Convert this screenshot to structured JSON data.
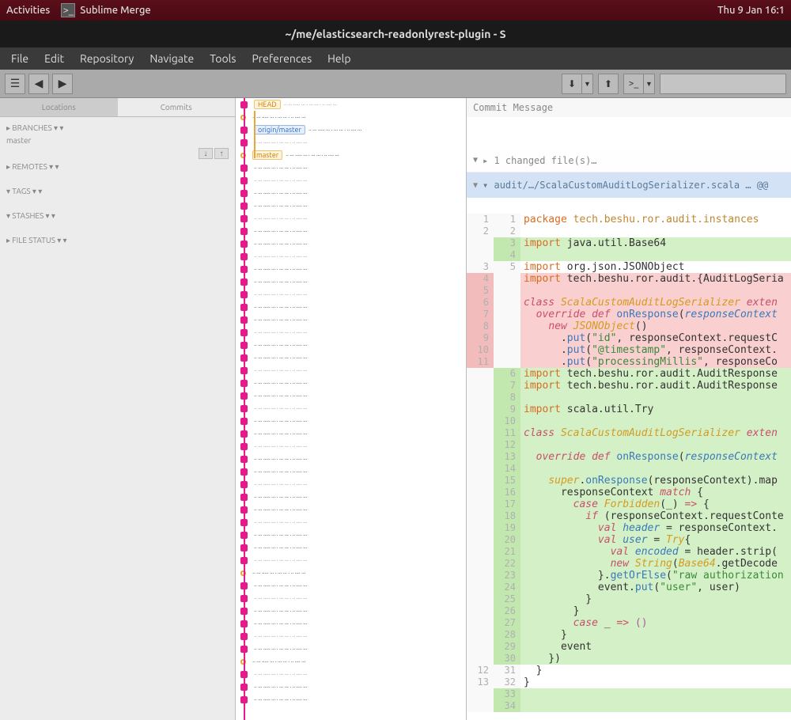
{
  "ubuntu": {
    "activities": "Activities",
    "app_icon_glyph": ">_",
    "app_name": "Sublime Merge",
    "clock": "Thu 9 Jan  16:1"
  },
  "window": {
    "title": "~/me/elasticsearch-readonlyrest-plugin - S"
  },
  "menu": [
    "File",
    "Edit",
    "Repository",
    "Navigate",
    "Tools",
    "Preferences",
    "Help"
  ],
  "toolbar": {
    "hamburger": "☰",
    "back": "◀",
    "forward": "▶",
    "pull_icon": "⬇",
    "push_icon": "⬆",
    "stash_icon": ">_",
    "drop_glyph": "▼",
    "search_placeholder": ""
  },
  "sidebar": {
    "tab1": "Locations",
    "tab2": "Commits",
    "branch1": "▸ BRANCHES ▾ ▾",
    "branch1b": "   master",
    "remotes": "▸ REMOTES ▾ ▾",
    "tags": "▾ TAGS ▾ ▾",
    "stashes": "▾ STASHES ▾ ▾",
    "submodules": "",
    "more": "▸ FILE STATUS ▾ ▾"
  },
  "graph_tags": {
    "head": "HEAD",
    "origin_master": "origin/master",
    "master": "master"
  },
  "diff": {
    "commit_msg_label": "Commit Message",
    "files_label": "▸ 1 changed file(s)…",
    "hunk_label": "▾ audit/…/ScalaCustomAuditLogSerializer.scala … @@"
  },
  "code_lines": [
    {
      "lo": "1",
      "ln": "1",
      "t": "context",
      "html": "<span class='kw2'>package</span> <span class='pkg'>tech.beshu.ror.audit.instances</span>"
    },
    {
      "lo": "2",
      "ln": "2",
      "t": "context",
      "html": ""
    },
    {
      "lo": "",
      "ln": "3",
      "t": "added",
      "html": "<span class='kw2'>import</span> java.util.Base64"
    },
    {
      "lo": "",
      "ln": "4",
      "t": "added",
      "html": ""
    },
    {
      "lo": "3",
      "ln": "5",
      "t": "context",
      "html": "<span class='kw2'>import</span> org.json.JSONObject"
    },
    {
      "lo": "4",
      "ln": "",
      "t": "removed",
      "html": "<span class='kw2'>import</span> tech.beshu.ror.audit.{AuditLogSeria"
    },
    {
      "lo": "5",
      "ln": "",
      "t": "removed",
      "html": ""
    },
    {
      "lo": "6",
      "ln": "",
      "t": "removed",
      "html": "<span class='kw'>class</span> <span class='cls'>ScalaCustomAuditLogSerializer</span> <span class='kw'>exten</span>"
    },
    {
      "lo": "7",
      "ln": "",
      "t": "removed",
      "html": "  <span class='kw'>override</span> <span class='kw'>def</span> <span class='fn'>onResponse</span>(<span class='var'>responseContext</span>"
    },
    {
      "lo": "8",
      "ln": "",
      "t": "removed",
      "html": "    <span class='kw'>new</span> <span class='cls'>JSONObject</span>()"
    },
    {
      "lo": "9",
      "ln": "",
      "t": "removed",
      "html": "      .<span class='fn'>put</span>(<span class='str'>\"id\"</span>, responseContext.requestC"
    },
    {
      "lo": "10",
      "ln": "",
      "t": "removed",
      "html": "      .<span class='fn'>put</span>(<span class='str'>\"@timestamp\"</span>, responseContext."
    },
    {
      "lo": "11",
      "ln": "",
      "t": "removed",
      "html": "      .<span class='fn'>put</span>(<span class='str'>\"processingMillis\"</span>, responseCo"
    },
    {
      "lo": "",
      "ln": "6",
      "t": "added",
      "html": "<span class='kw2'>import</span> tech.beshu.ror.audit.AuditResponse"
    },
    {
      "lo": "",
      "ln": "7",
      "t": "added",
      "html": "<span class='kw2'>import</span> tech.beshu.ror.audit.AuditResponse"
    },
    {
      "lo": "",
      "ln": "8",
      "t": "added",
      "html": ""
    },
    {
      "lo": "",
      "ln": "9",
      "t": "added",
      "html": "<span class='kw2'>import</span> scala.util.Try"
    },
    {
      "lo": "",
      "ln": "10",
      "t": "added",
      "html": ""
    },
    {
      "lo": "",
      "ln": "11",
      "t": "added",
      "html": "<span class='kw'>class</span> <span class='cls'>ScalaCustomAuditLogSerializer</span> <span class='kw'>exten</span>"
    },
    {
      "lo": "",
      "ln": "12",
      "t": "added",
      "html": ""
    },
    {
      "lo": "",
      "ln": "13",
      "t": "added",
      "html": "  <span class='kw'>override</span> <span class='kw'>def</span> <span class='fn'>onResponse</span>(<span class='var'>responseContext</span>"
    },
    {
      "lo": "",
      "ln": "14",
      "t": "added",
      "html": ""
    },
    {
      "lo": "",
      "ln": "15",
      "t": "added",
      "html": "    <span class='cls'>super</span>.<span class='fn'>onResponse</span>(responseContext).map"
    },
    {
      "lo": "",
      "ln": "16",
      "t": "added",
      "html": "      responseContext <span class='kw'>match</span> {"
    },
    {
      "lo": "",
      "ln": "17",
      "t": "added",
      "html": "        <span class='kw'>case</span> <span class='cls'>Forbidden</span>(_) <span class='kw'>=></span> {"
    },
    {
      "lo": "",
      "ln": "18",
      "t": "added",
      "html": "          <span class='kw'>if</span> (responseContext.requestConte"
    },
    {
      "lo": "",
      "ln": "19",
      "t": "added",
      "html": "            <span class='kw'>val</span> <span class='var'>header</span> = responseContext."
    },
    {
      "lo": "",
      "ln": "20",
      "t": "added",
      "html": "            <span class='kw'>val</span> <span class='var'>user</span> = <span class='cls'>Try</span>{"
    },
    {
      "lo": "",
      "ln": "21",
      "t": "added",
      "html": "              <span class='kw'>val</span> <span class='var'>encoded</span> = header.strip("
    },
    {
      "lo": "",
      "ln": "22",
      "t": "added",
      "html": "              <span class='kw'>new</span> <span class='cls'>String</span>(<span class='cls'>Base64</span>.getDecode"
    },
    {
      "lo": "",
      "ln": "23",
      "t": "added",
      "html": "            }.<span class='fn'>getOrElse</span>(<span class='str'>\"raw authorization</span>"
    },
    {
      "lo": "",
      "ln": "24",
      "t": "added",
      "html": "            event.<span class='fn'>put</span>(<span class='str'>\"user\"</span>, user)"
    },
    {
      "lo": "",
      "ln": "25",
      "t": "added",
      "html": "          }"
    },
    {
      "lo": "",
      "ln": "26",
      "t": "added",
      "html": "        }"
    },
    {
      "lo": "",
      "ln": "27",
      "t": "added",
      "html": "        <span class='kw'>case</span> _ <span class='kw'>=></span> <span class='num'>()</span>"
    },
    {
      "lo": "",
      "ln": "28",
      "t": "added",
      "html": "      }"
    },
    {
      "lo": "",
      "ln": "29",
      "t": "added",
      "html": "      event"
    },
    {
      "lo": "",
      "ln": "30",
      "t": "added",
      "html": "    })"
    },
    {
      "lo": "12",
      "ln": "31",
      "t": "context",
      "html": "  }"
    },
    {
      "lo": "13",
      "ln": "32",
      "t": "context",
      "html": "}"
    },
    {
      "lo": "",
      "ln": "33",
      "t": "added",
      "html": ""
    },
    {
      "lo": "",
      "ln": "34",
      "t": "added",
      "html": ""
    }
  ]
}
